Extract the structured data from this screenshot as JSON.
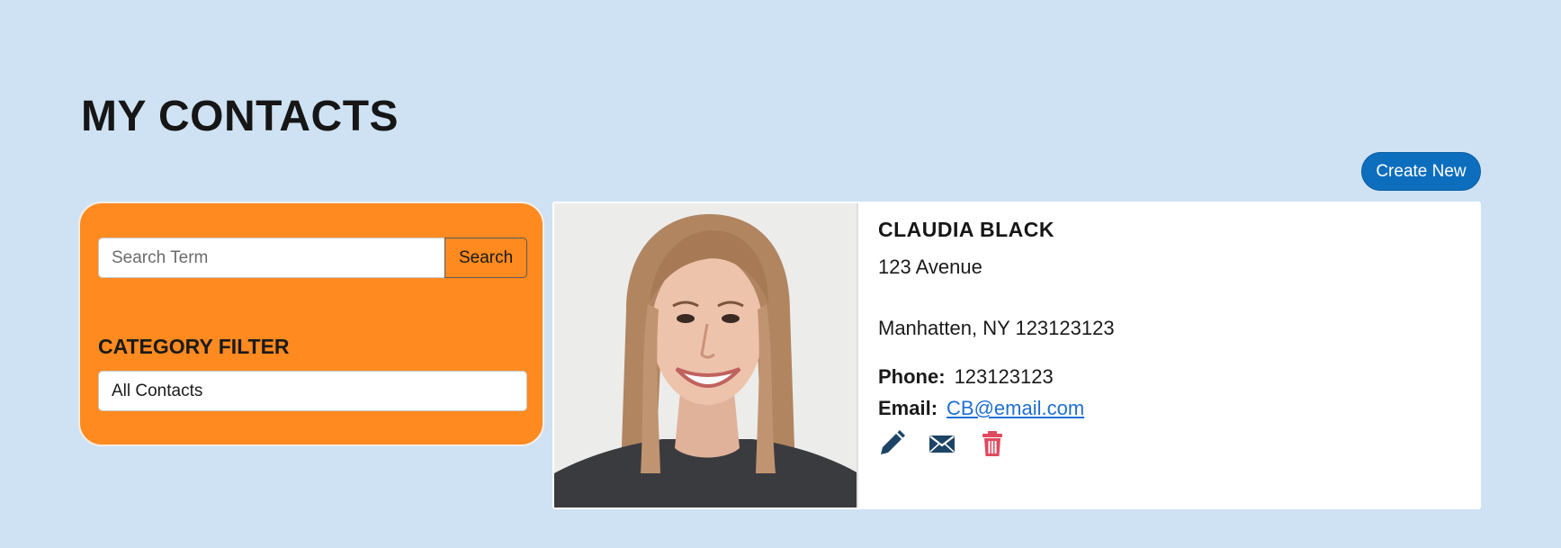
{
  "page": {
    "title": "MY CONTACTS"
  },
  "toolbar": {
    "create_label": "Create New"
  },
  "search": {
    "placeholder": "Search Term",
    "value": "",
    "button_label": "Search"
  },
  "filter": {
    "heading": "CATEGORY FILTER",
    "selected": "All Contacts"
  },
  "contact": {
    "name": "CLAUDIA BLACK",
    "address_line1": "123 Avenue",
    "address_line2": "Manhatten, NY 123123123",
    "phone_label": "Phone:",
    "phone": "123123123",
    "email_label": "Email:",
    "email": "CB@email.com",
    "actions": [
      "pencil-icon",
      "envelope-icon",
      "trash-icon"
    ]
  },
  "colors": {
    "background": "#cfe2f3",
    "panel": "#fe8a20",
    "accent": "#0d6ebd",
    "icon": "#1d4466",
    "delete": "#e04a5e",
    "link": "#1f6fd1"
  }
}
